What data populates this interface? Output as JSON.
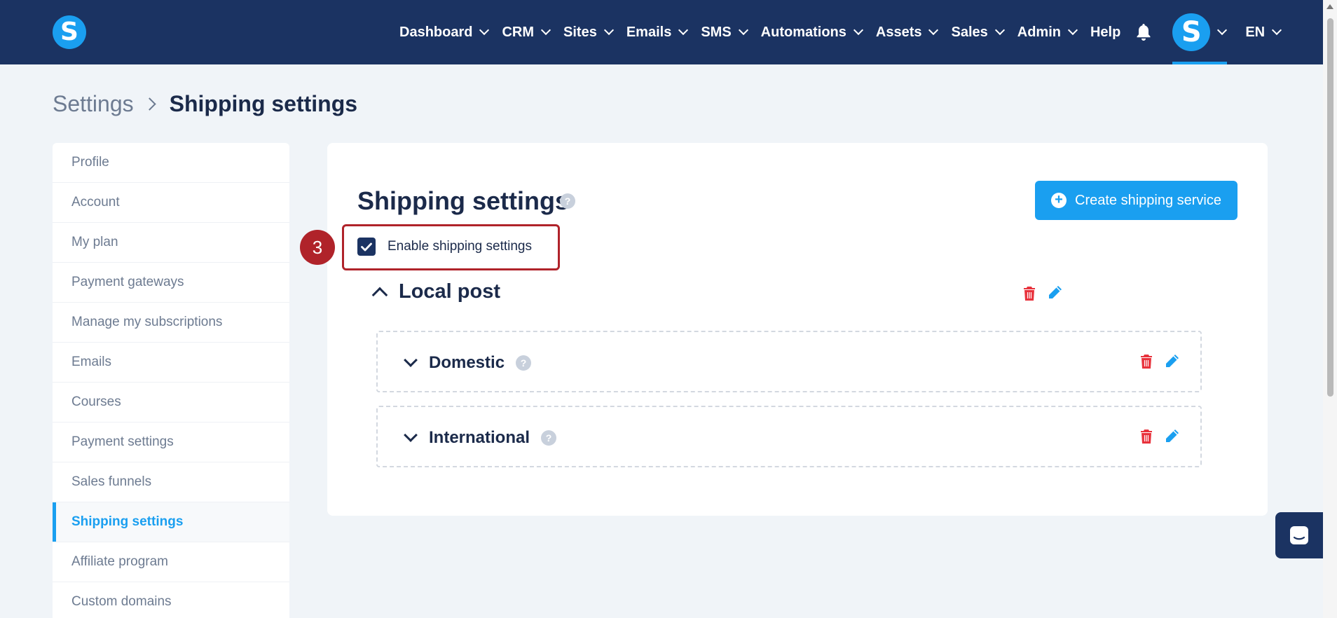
{
  "logo": {
    "letter": "S"
  },
  "nav": {
    "items": [
      {
        "label": "Dashboard",
        "dropdown": true
      },
      {
        "label": "CRM",
        "dropdown": true
      },
      {
        "label": "Sites",
        "dropdown": true
      },
      {
        "label": "Emails",
        "dropdown": true
      },
      {
        "label": "SMS",
        "dropdown": true
      },
      {
        "label": "Automations",
        "dropdown": true
      },
      {
        "label": "Assets",
        "dropdown": true
      },
      {
        "label": "Sales",
        "dropdown": true
      },
      {
        "label": "Admin",
        "dropdown": true
      },
      {
        "label": "Help",
        "dropdown": false
      }
    ],
    "avatar_letter": "S",
    "language": "EN"
  },
  "breadcrumb": {
    "parent": "Settings",
    "current": "Shipping settings"
  },
  "sidebar": {
    "items": [
      {
        "label": "Profile"
      },
      {
        "label": "Account"
      },
      {
        "label": "My plan"
      },
      {
        "label": "Payment gateways"
      },
      {
        "label": "Manage my subscriptions"
      },
      {
        "label": "Emails"
      },
      {
        "label": "Courses"
      },
      {
        "label": "Payment settings"
      },
      {
        "label": "Sales funnels"
      },
      {
        "label": "Shipping settings",
        "active": true
      },
      {
        "label": "Affiliate program"
      },
      {
        "label": "Custom domains"
      }
    ]
  },
  "main": {
    "title": "Shipping settings",
    "help_glyph": "?",
    "create_button": "Create shipping service",
    "create_icon": "+",
    "enable_label": "Enable shipping settings",
    "enabled": true,
    "step_badge": "3",
    "group": {
      "name": "Local post",
      "zones": [
        {
          "name": "Domestic"
        },
        {
          "name": "International"
        }
      ]
    }
  },
  "colors": {
    "navbar": "#1b3362",
    "accent": "#1a9ff0",
    "delete": "#e8323c",
    "highlight": "#b0232a"
  }
}
